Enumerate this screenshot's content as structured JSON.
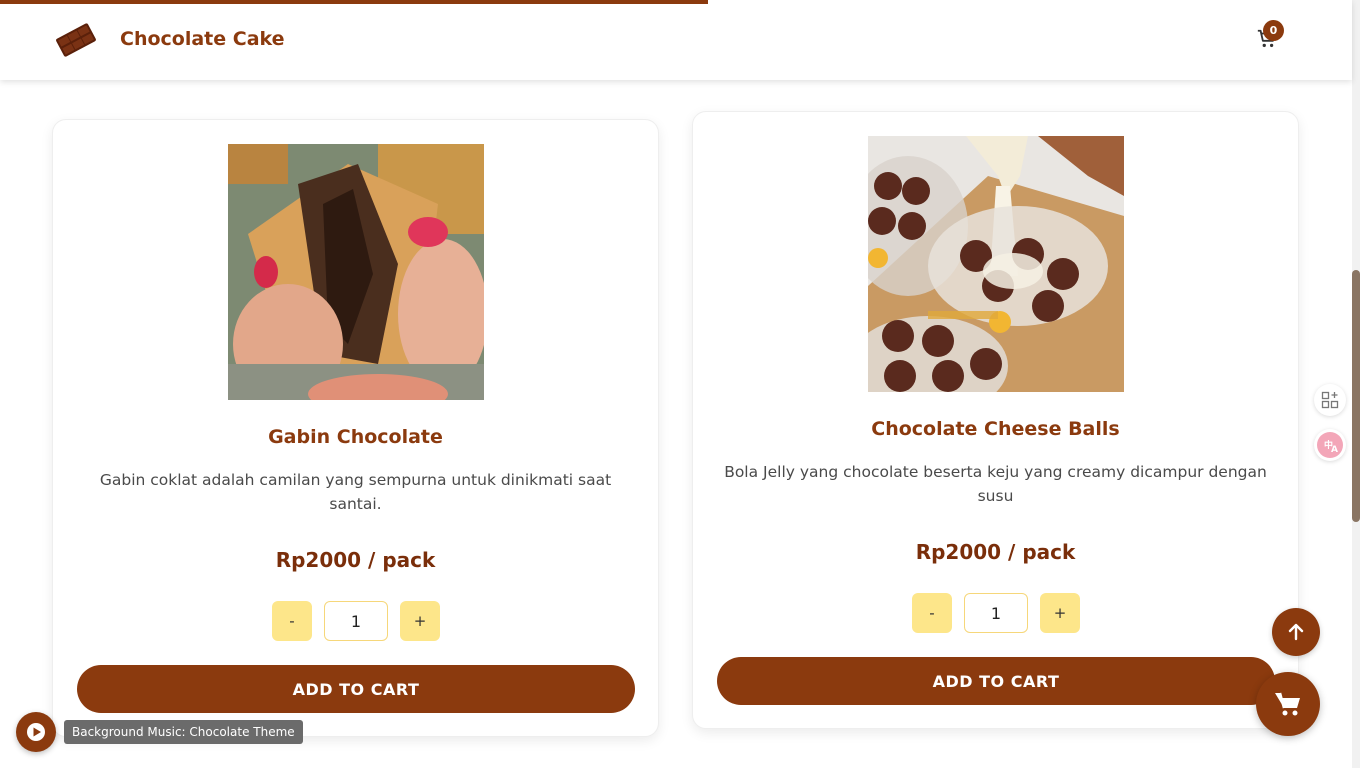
{
  "header": {
    "brand": "Chocolate Cake",
    "cart_count": "0",
    "page_progress_percent": 52
  },
  "products": [
    {
      "name": "Gabin Chocolate",
      "description": "Gabin coklat adalah camilan yang sempurna untuk dinikmati saat santai.",
      "price": "Rp2000 / pack",
      "quantity": "1",
      "minus_label": "-",
      "plus_label": "+",
      "add_label": "ADD TO CART"
    },
    {
      "name": "Chocolate Cheese Balls",
      "description": "Bola Jelly yang chocolate beserta keju yang creamy dicampur dengan susu",
      "price": "Rp2000 / pack",
      "quantity": "1",
      "minus_label": "-",
      "plus_label": "+",
      "add_label": "ADD TO CART"
    }
  ],
  "music": {
    "label": "Background Music: Chocolate Theme"
  },
  "colors": {
    "brand": "#8b3a0e",
    "qty_button": "#fde68a"
  },
  "icons": [
    "chocolate-logo-icon",
    "cart-icon",
    "scroll-top-icon",
    "play-icon",
    "apps-icon",
    "translate-icon"
  ]
}
